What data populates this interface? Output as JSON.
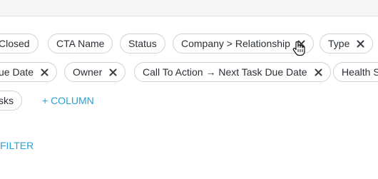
{
  "row1": [
    {
      "label": "Closed",
      "removable": false
    },
    {
      "label": "CTA Name",
      "removable": false
    },
    {
      "label": "Status",
      "removable": false
    },
    {
      "label": "Company > Relationship",
      "removable": true
    },
    {
      "label": "Type",
      "removable": true
    }
  ],
  "row2": [
    {
      "label": "ue Date",
      "removable": true
    },
    {
      "label": "Owner",
      "removable": true
    },
    {
      "label": "Call To Action → Next Task Due Date",
      "removable": true
    },
    {
      "label": "Health S",
      "removable": false
    }
  ],
  "row3": [
    {
      "label": "sks",
      "removable": false
    }
  ],
  "add_column_label": "+ COLUMN",
  "filter_label": "FILTER",
  "colors": {
    "accent": "#25a2d6",
    "chip_border": "#cfd3d8",
    "text": "#2b3036"
  }
}
